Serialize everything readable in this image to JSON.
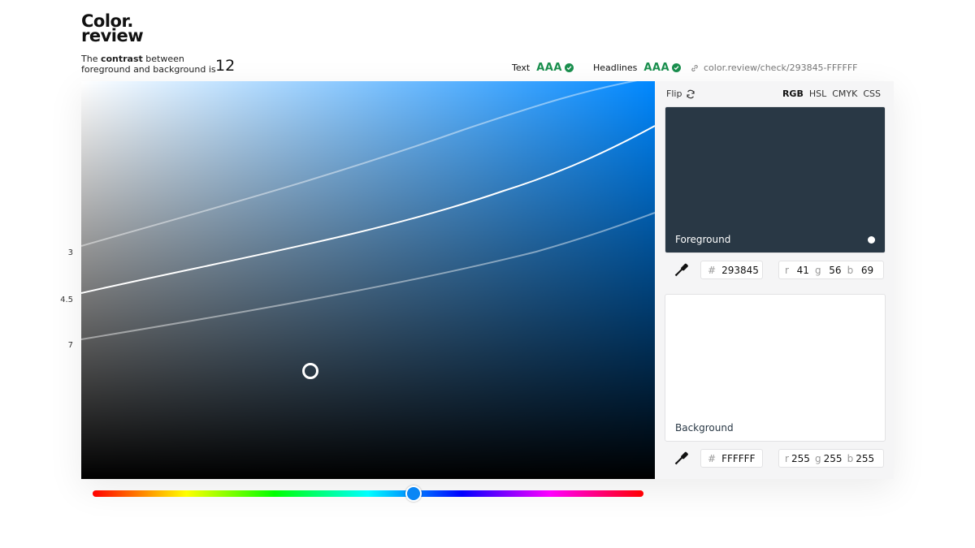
{
  "logo": {
    "line1": "Color.",
    "line2": "review"
  },
  "summary": {
    "prefix": "The ",
    "bold": "contrast",
    "mid": " between",
    "line2": "foreground and background is",
    "ratio": "12"
  },
  "badges": {
    "text_label": "Text",
    "text_level": "AAA",
    "headlines_label": "Headlines",
    "headlines_level": "AAA"
  },
  "share_link": "color.review/check/293845-FFFFFF",
  "picker": {
    "hue_color": "#0088ff",
    "curve_labels": [
      "3",
      "4.5",
      "7"
    ]
  },
  "panel": {
    "flip_label": "Flip",
    "modes": [
      "RGB",
      "HSL",
      "CMYK",
      "CSS"
    ],
    "active_mode": "RGB"
  },
  "foreground": {
    "label": "Foreground",
    "hex": "293845",
    "color": "#293845",
    "r": "41",
    "g": "56",
    "b": "69"
  },
  "background": {
    "label": "Background",
    "hex": "FFFFFF",
    "color": "#FFFFFF",
    "r": "255",
    "g": "255",
    "b": "255"
  },
  "channel_labels": {
    "r": "r",
    "g": "g",
    "b": "b",
    "hash": "#"
  },
  "colors": {
    "pass_green": "#1a8f4e",
    "hue_thumb": "#0a86f5"
  }
}
